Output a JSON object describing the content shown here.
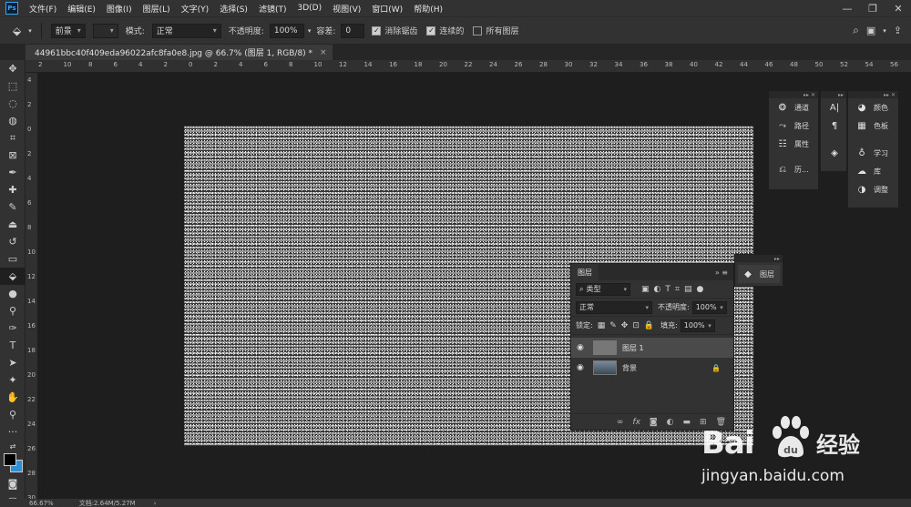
{
  "menubar": {
    "logo": "Ps",
    "items": [
      "文件(F)",
      "编辑(E)",
      "图像(I)",
      "图层(L)",
      "文字(Y)",
      "选择(S)",
      "滤镜(T)",
      "3D(D)",
      "视图(V)",
      "窗口(W)",
      "帮助(H)"
    ]
  },
  "options": {
    "fill_source": "前景",
    "mode_label": "模式:",
    "mode_value": "正常",
    "opacity_label": "不透明度:",
    "opacity_value": "100%",
    "tolerance_label": "容差:",
    "tolerance_value": "0",
    "antialias_label": "消除锯齿",
    "antialias_checked": true,
    "contiguous_label": "连续的",
    "contiguous_checked": true,
    "all_layers_label": "所有图层",
    "all_layers_checked": false
  },
  "document_tab": {
    "title": "44961bbc40f409eda96022afc8fa0e8.jpg @ 66.7% (图层 1, RGB/8) *",
    "close": "×"
  },
  "ruler": {
    "h_ticks": [
      "2",
      "10",
      "8",
      "6",
      "4",
      "2",
      "0",
      "2",
      "4",
      "6",
      "8",
      "10",
      "12",
      "14",
      "16",
      "18",
      "20",
      "22",
      "24",
      "26",
      "28",
      "30",
      "32",
      "34",
      "36",
      "38",
      "40",
      "42",
      "44",
      "46",
      "48",
      "50",
      "52",
      "54",
      "56"
    ],
    "v_ticks": [
      "4",
      "2",
      "0",
      "2",
      "4",
      "6",
      "8",
      "10",
      "12",
      "14",
      "16",
      "18",
      "20",
      "22",
      "24",
      "26",
      "28",
      "30"
    ]
  },
  "panels": {
    "channels": "通道",
    "paths": "路径",
    "properties": "属性",
    "history": "历...",
    "color": "颜色",
    "swatches": "色板",
    "learn": "学习",
    "libraries": "库",
    "adjustments": "调整",
    "layers_dock": "图层"
  },
  "layers": {
    "title": "图层",
    "filter_kind": "类型",
    "blend_mode": "正常",
    "opacity_label": "不透明度:",
    "opacity_value": "100%",
    "lock_label": "锁定:",
    "fill_label": "填充:",
    "fill_value": "100%",
    "items": [
      {
        "name": "图层 1",
        "selected": true
      },
      {
        "name": "背景",
        "selected": false
      }
    ]
  },
  "status": {
    "zoom": "66.67%",
    "doc_info": "文档:2.64M/5.27M"
  },
  "watermark": {
    "brand": "Bai",
    "brand_tail": "经验",
    "url": "jingyan.baidu.com"
  }
}
